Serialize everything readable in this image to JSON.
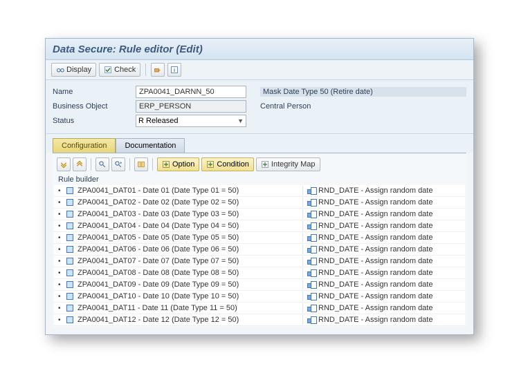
{
  "window": {
    "title": "Data Secure: Rule editor (Edit)"
  },
  "toolbar": {
    "display_label": "Display",
    "check_label": "Check"
  },
  "form": {
    "name_label": "Name",
    "name_value": "ZPA0041_DARNN_50",
    "name_desc": "Mask Date Type 50 (Retire date)",
    "bo_label": "Business Object",
    "bo_value": "ERP_PERSON",
    "bo_desc": "Central Person",
    "status_label": "Status",
    "status_value": "R Released"
  },
  "tabs": {
    "configuration": "Configuration",
    "documentation": "Documentation"
  },
  "inner_toolbar": {
    "option": "Option",
    "condition": "Condition",
    "integrity": "Integrity Map"
  },
  "rule_builder": {
    "header": "Rule builder",
    "rows": [
      {
        "left": "ZPA0041_DAT01 - Date 01 (Date Type 01 = 50)",
        "right": "RND_DATE - Assign random date"
      },
      {
        "left": "ZPA0041_DAT02 - Date 02 (Date Type 02 = 50)",
        "right": "RND_DATE - Assign random date"
      },
      {
        "left": "ZPA0041_DAT03 - Date 03 (Date Type 03 = 50)",
        "right": "RND_DATE - Assign random date"
      },
      {
        "left": "ZPA0041_DAT04 - Date 04 (Date Type 04 = 50)",
        "right": "RND_DATE - Assign random date"
      },
      {
        "left": "ZPA0041_DAT05 - Date 05 (Date Type 05 = 50)",
        "right": "RND_DATE - Assign random date"
      },
      {
        "left": "ZPA0041_DAT06 - Date 06 (Date Type 06 = 50)",
        "right": "RND_DATE - Assign random date"
      },
      {
        "left": "ZPA0041_DAT07 - Date 07 (Date Type 07 = 50)",
        "right": "RND_DATE - Assign random date"
      },
      {
        "left": "ZPA0041_DAT08 - Date 08 (Date Type 08 = 50)",
        "right": "RND_DATE - Assign random date"
      },
      {
        "left": "ZPA0041_DAT09 - Date 09 (Date Type 09 = 50)",
        "right": "RND_DATE - Assign random date"
      },
      {
        "left": "ZPA0041_DAT10 - Date 10 (Date Type 10 = 50)",
        "right": "RND_DATE - Assign random date"
      },
      {
        "left": "ZPA0041_DAT11 - Date 11 (Date Type 11 = 50)",
        "right": "RND_DATE - Assign random date"
      },
      {
        "left": "ZPA0041_DAT12 - Date 12 (Date Type 12 = 50)",
        "right": "RND_DATE - Assign random date"
      }
    ]
  }
}
